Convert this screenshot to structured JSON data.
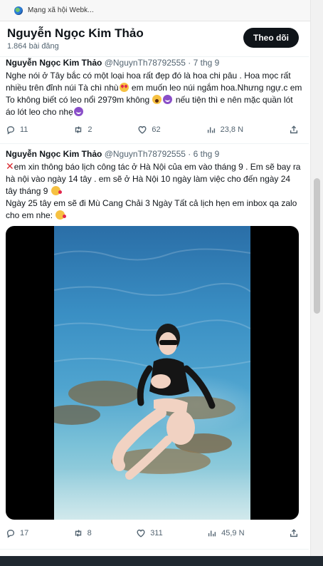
{
  "browser": {
    "tab_title": "Mạng xã hội Webk..."
  },
  "profile": {
    "name": "Nguyễn Ngọc Kim Thảo",
    "post_count": "1.864 bài đăng",
    "follow_label": "Theo dõi"
  },
  "tweets": [
    {
      "name": "Nguyễn Ngọc Kim Thảo",
      "handle": "@NguynTh78792555",
      "dot": "·",
      "date": "7 thg 9",
      "text_parts": [
        "Nghe nói ở Tây bắc có một loại hoa rất đẹp đó là hoa chi pâu . Hoa mọc rất nhiều trên đỉnh núi Tà chì nhù",
        " em muốn leo núi ngắm hoa.Nhưng ngự.c em To không biết có leo nổi 2979m không ",
        " nếu tiện thì e nên mặc quần lót áo lót leo cho nhẹ"
      ],
      "emojis": [
        "heart-eyes-emoji",
        "scream-emoji",
        "devil-emoji",
        "devil-emoji"
      ],
      "stats": {
        "replies": "11",
        "reposts": "2",
        "likes": "62",
        "views": "23,8 N"
      }
    },
    {
      "name": "Nguyễn Ngọc Kim Thảo",
      "handle": "@NguynTh78792555",
      "dot": "·",
      "date": "6 thg 9",
      "text_parts": [
        "em xin thông báo lịch công tác ở Hà Nội của em vào tháng 9 . Em sẽ bay ra hà nội vào ngày 14 tây . em sẽ ở Hà Nội 10 ngày làm việc cho đến ngày 24 tây tháng 9",
        "Ngày 25 tây em sẽ đi Mù Cang Chải  3 Ngày Tất cả lịch hẹn em inbox qa zalo cho em nhe:"
      ],
      "emojis": [
        "cross-mark-emoji",
        "kiss-emoji",
        "kiss-emoji"
      ],
      "stats": {
        "replies": "17",
        "reposts": "8",
        "likes": "311",
        "views": "45,9 N"
      }
    }
  ],
  "icons": [
    "reply-icon",
    "repost-icon",
    "like-icon",
    "views-icon",
    "share-icon"
  ],
  "colors": {
    "text": "#0f1419",
    "secondary": "#536471",
    "button_bg": "#0f1419",
    "button_text": "#ffffff",
    "divider": "#eff3f4"
  }
}
